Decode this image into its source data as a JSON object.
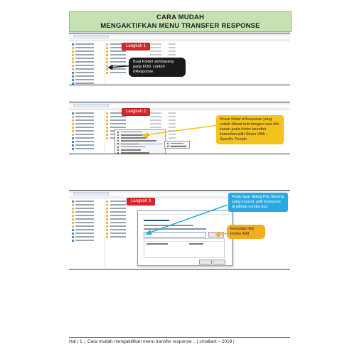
{
  "title": {
    "line1": "CARA MUDAH",
    "line2": "MENGAKTIFKAN MENU TRANSFER RESPONSE"
  },
  "steps": [
    {
      "label": "Langkah 1",
      "callouts": [
        "Buat Folder sembarang pada FDD, contoh trResponse"
      ]
    },
    {
      "label": "Langkah 2",
      "callouts": [
        "Share folder trResponse yang sudah dibuat tadi dengan cara klik kanan pada folder tersebut kemudian pilih Share With – Specific People"
      ]
    },
    {
      "label": "Langkah 3",
      "callouts": [
        "Pada layar dialog File Sharing yang muncul, pilih Everyone di pilihan combo box",
        "kemudian klik tombo Add"
      ]
    }
  ],
  "footer": {
    "text": "Hal | 1 .: Cara mudah mengaktifkan menu transfer response :. | smallant – 2018 |"
  },
  "colors": {
    "title_bg": "#c6e2b3",
    "step_badge": "#d7262c",
    "callout_dark": "#1a1a1a",
    "callout_yellow": "#f4c21c",
    "callout_blue": "#29a9e0",
    "callout_orange": "#f2ad20"
  }
}
